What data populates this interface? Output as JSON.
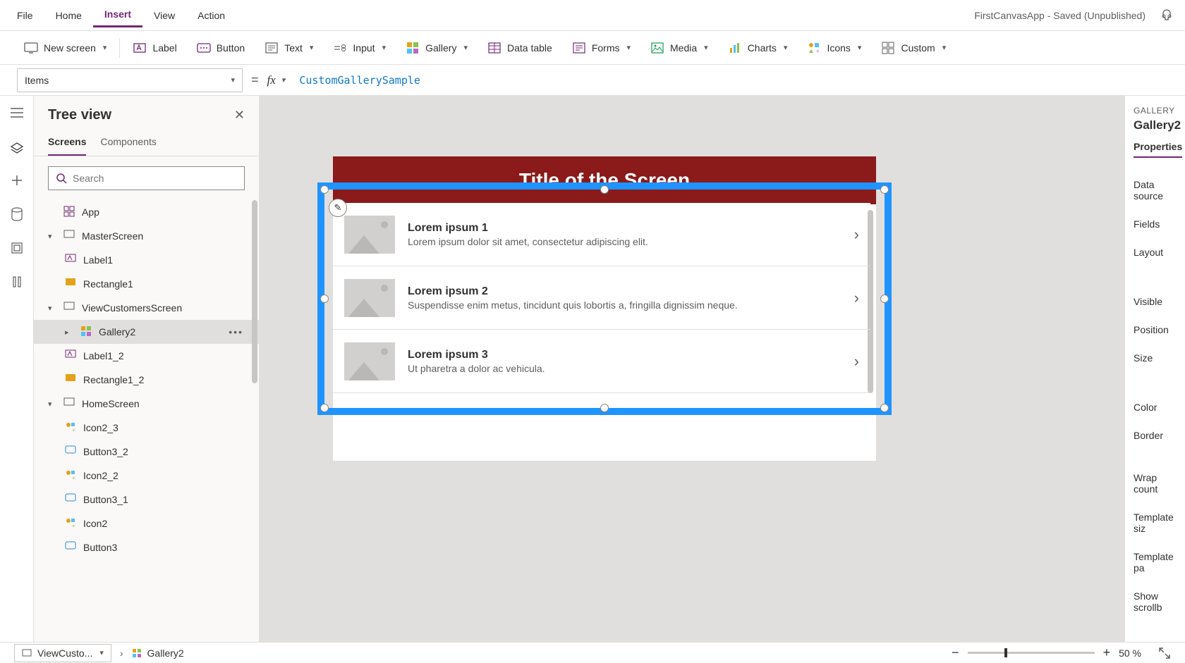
{
  "menu": {
    "items": [
      "File",
      "Home",
      "Insert",
      "View",
      "Action"
    ],
    "active": "Insert",
    "appTitle": "FirstCanvasApp - Saved (Unpublished)"
  },
  "ribbon": {
    "newScreen": "New screen",
    "label": "Label",
    "button": "Button",
    "text": "Text",
    "input": "Input",
    "gallery": "Gallery",
    "dataTable": "Data table",
    "forms": "Forms",
    "media": "Media",
    "charts": "Charts",
    "icons": "Icons",
    "custom": "Custom"
  },
  "formula": {
    "property": "Items",
    "value": "CustomGallerySample"
  },
  "tree": {
    "title": "Tree view",
    "tabs": [
      "Screens",
      "Components"
    ],
    "activeTab": "Screens",
    "searchPlaceholder": "Search",
    "nodes": {
      "app": "App",
      "master": "MasterScreen",
      "label1": "Label1",
      "rect1": "Rectangle1",
      "view": "ViewCustomersScreen",
      "gallery2": "Gallery2",
      "label12": "Label1_2",
      "rect12": "Rectangle1_2",
      "home": "HomeScreen",
      "icon23": "Icon2_3",
      "btn32": "Button3_2",
      "icon22": "Icon2_2",
      "btn31": "Button3_1",
      "icon2": "Icon2",
      "btn3": "Button3"
    }
  },
  "canvas": {
    "title": "Title of the Screen",
    "rows": [
      {
        "t": "Lorem ipsum 1",
        "s": "Lorem ipsum dolor sit amet, consectetur adipiscing elit."
      },
      {
        "t": "Lorem ipsum 2",
        "s": "Suspendisse enim metus, tincidunt quis lobortis a, fringilla dignissim neque."
      },
      {
        "t": "Lorem ipsum 3",
        "s": "Ut pharetra a dolor ac vehicula."
      }
    ]
  },
  "props": {
    "category": "GALLERY",
    "name": "Gallery2",
    "tab": "Properties",
    "rows": [
      "Data source",
      "Fields",
      "Layout",
      "Visible",
      "Position",
      "Size",
      "Color",
      "Border",
      "Wrap count",
      "Template siz",
      "Template pa",
      "Show scrollb"
    ]
  },
  "status": {
    "crumb1": "ViewCusto...",
    "crumb2": "Gallery2",
    "zoom": "50  %"
  }
}
